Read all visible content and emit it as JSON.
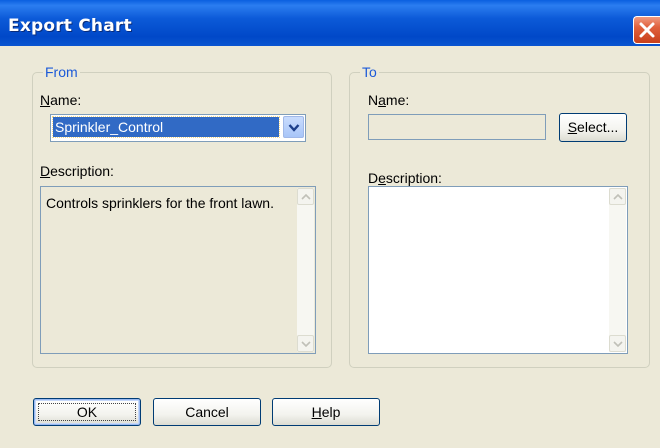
{
  "window": {
    "title": "Export Chart"
  },
  "from": {
    "legend": "From",
    "name_label": "Name:",
    "name_value": "Sprinkler_Control",
    "description_label": "Description:",
    "description_text": "Controls sprinklers for the front lawn."
  },
  "to": {
    "legend": "To",
    "name_label": "Name:",
    "name_value": "",
    "select_button": "Select...",
    "description_label": "Description:",
    "description_text": ""
  },
  "buttons": {
    "ok": "OK",
    "cancel": "Cancel",
    "help": "Help"
  },
  "icons": {
    "close": "close-icon",
    "dropdown": "chevron-down-icon",
    "scroll_up": "scroll-up-arrow-icon",
    "scroll_down": "scroll-down-arrow-icon"
  },
  "colors": {
    "titlebar": "#0054e3",
    "legend_text": "#1c5ad8",
    "selection": "#316ac5",
    "close_button": "#e0603c",
    "dialog_bg": "#ece9d8"
  }
}
